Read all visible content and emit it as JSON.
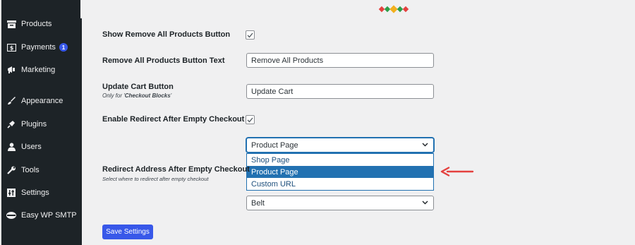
{
  "sidebar": {
    "items": [
      {
        "label": "Products",
        "icon": "archive-icon"
      },
      {
        "label": "Payments",
        "icon": "payments-icon",
        "badge": "1"
      },
      {
        "label": "Marketing",
        "icon": "megaphone-icon"
      },
      {
        "label": "Appearance",
        "icon": "paintbrush-icon"
      },
      {
        "label": "Plugins",
        "icon": "plug-icon"
      },
      {
        "label": "Users",
        "icon": "user-icon"
      },
      {
        "label": "Tools",
        "icon": "wrench-icon"
      },
      {
        "label": "Settings",
        "icon": "settings-sliders-icon"
      },
      {
        "label": "Easy WP SMTP",
        "icon": "mail-icon"
      }
    ]
  },
  "settings": {
    "show_remove_all": {
      "label": "Show Remove All Products Button",
      "checked": true
    },
    "remove_all_text": {
      "label": "Remove All Products Button Text",
      "value": "Remove All Products"
    },
    "update_cart": {
      "label": "Update Cart Button",
      "note_prefix": "Only for '",
      "note_strong": "Checkout Blocks",
      "note_suffix": "'",
      "value": "Update Cart"
    },
    "enable_redirect": {
      "label": "Enable Redirect After Empty Checkout",
      "checked": true
    },
    "redirect_address": {
      "label": "Redirect Address After Empty Checkout",
      "description": "Select where to redirect after empty checkout",
      "selected": "Product Page",
      "options": [
        "Shop Page",
        "Product Page",
        "Custom URL"
      ]
    },
    "product_select": {
      "selected": "Belt"
    },
    "save_label": "Save Settings"
  },
  "colors": {
    "accent": "#3858e9",
    "select_highlight": "#2271b1",
    "annotation_arrow": "#e4413f",
    "sidebar_bg": "#1d2327"
  }
}
